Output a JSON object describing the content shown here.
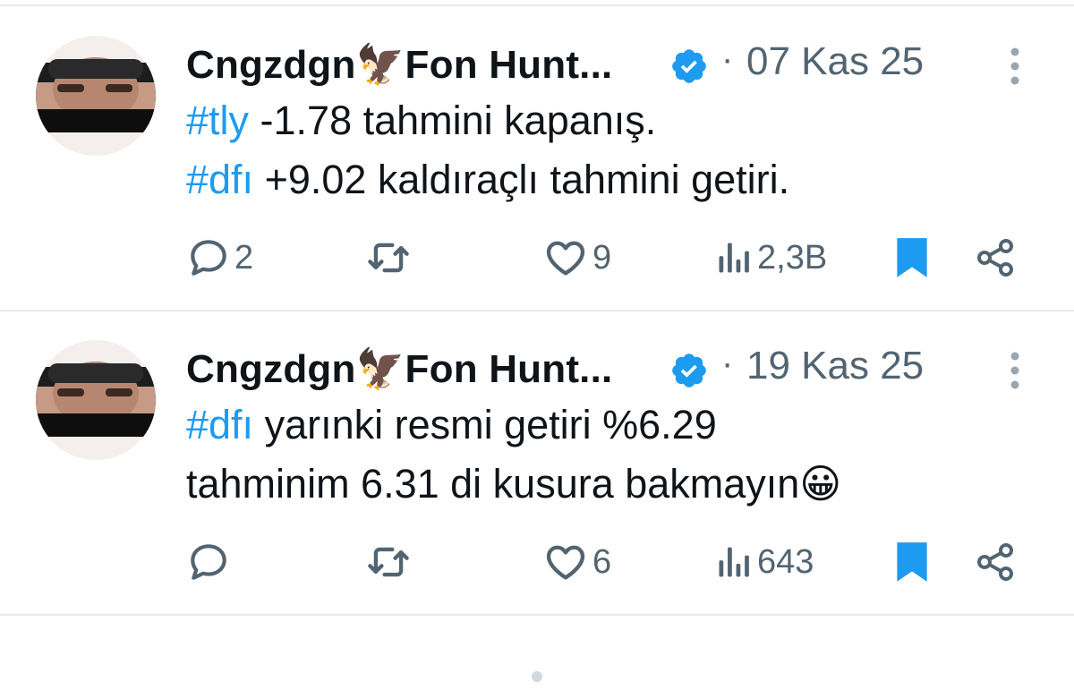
{
  "tweets": [
    {
      "author": "Cngzdgn🦅Fon Hunt...",
      "dot": "·",
      "date": "07 Kas 25",
      "line1_tag": "#tly",
      "line1_rest": " -1.78 tahmini kapanış.",
      "line2_tag": "#dfı",
      "line2_rest": " +9.02 kaldıraçlı tahmini getiri.",
      "replies": "2",
      "retweets": "",
      "likes": "9",
      "views": "2,3B"
    },
    {
      "author": "Cngzdgn🦅Fon Hunt...",
      "dot": "·",
      "date": "19 Kas 25",
      "line1_tag": "#dfı",
      "line1_rest": " yarınki resmi getiri %6.29",
      "line2_tag": "",
      "line2_rest": "tahminim 6.31 di kusura bakmayın😀",
      "replies": "",
      "retweets": "",
      "likes": "6",
      "views": "643"
    }
  ],
  "icons": {
    "verified": "verified-badge-icon",
    "more": "more-vertical-icon",
    "reply": "reply-icon",
    "retweet": "retweet-icon",
    "like": "heart-icon",
    "views": "views-icon",
    "bookmark": "bookmark-icon",
    "share": "share-icon"
  },
  "colors": {
    "accent": "#1d9bf0",
    "text": "#0f1419",
    "muted": "#536471",
    "divider": "#e6e9ec"
  }
}
